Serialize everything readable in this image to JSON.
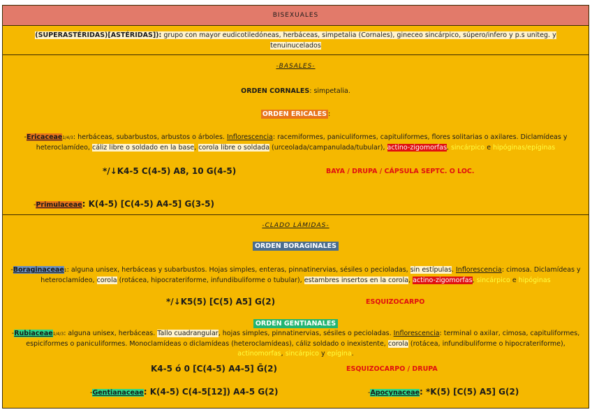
{
  "header": {
    "title": "BISEXUALES"
  },
  "intro": {
    "label": "(SUPERASTÉRIDAS)[ASTÉRIDAS]):",
    "text": " grupo con mayor eudicotiledóneas, herbáceas, simpetalia (Cornales), gineceo sincárpico, súpero/infero y p.s uniteg. y tenuinucelados"
  },
  "basales": {
    "title": "-BASALES-",
    "cornales_label": "ORDEN CORNALES",
    "cornales_text": ": simpetalia.",
    "ericales_label": "ORDEN ERICALES",
    "ericales_colon": ":",
    "ericaceae": {
      "name": "Ericaceae",
      "sub": "1/4/3",
      "t1": ": herbáceas, subarbustos, arbustos o árboles. ",
      "infl": "Inflorescencia",
      "t2": ": racemiformes, paniculiformes, capituliformes, flores solitarias o axilares. Diclamídeas y heteroclamídeo, ",
      "caliz": "cáliz libre o soldado en la base",
      "t3": ", ",
      "corola": "corola libre o soldada",
      "t4": " (urceolada/campanulada/tubular), ",
      "actino": "actino-zigomorfas",
      "comma": ", ",
      "sincarpico": "sincárpico",
      "e": " e ",
      "hipoginas": "hipóginas/epíginas",
      "formula": "*/↓K4-5 C(4-5) A8, 10 G(4-5)",
      "fruit": "BAYA / DRUPA / CÁPSULA SEPTC. O LOC."
    },
    "primulaceae": {
      "name": "Primulaceae",
      "formula": ": K(4-5) [C(4-5) A4-5] G(3-5)"
    }
  },
  "lamidas": {
    "title": "-CLADO LÁMIDAS-",
    "boraginales_label": "ORDEN BORAGINALES",
    "boraginaceae": {
      "name": "Boraginaceae",
      "sub": "1",
      "t1": ": alguna unisex, herbáceas y subarbustos. Hojas simples, enteras, pinnatinervias, sésiles o pecioladas, ",
      "sin": "sin estípulas",
      "t2": ". ",
      "infl": "Inflorescencia",
      "t3": ": cimosa. Diclamídeas y heteroclamídeo, ",
      "corola": "corola",
      "t4": " (rotácea, hipocrateriforme, infundibuliforme o tubular), ",
      "estambres": "estambres insertos en la corola",
      "comma": ", ",
      "actino": "actino-zigomorfas",
      "comma2": ", ",
      "sincarpico": "sincárpico",
      "e": " e ",
      "hipoginas": "hipóginas",
      "formula": "*/↓K5(5) [C(5) A5] G(2)",
      "fruit": "ESQUIZOCARPO"
    },
    "gentianales_label": "ORDEN GENTIANALES",
    "rubiaceae": {
      "name": "Rubiaceae",
      "sub": "1/4/3",
      "t1": ": alguna unisex, herbáceas. ",
      "tallo": "Tallo cuadrangular",
      "t2": ", hojas simples, pinnatinervias, sésiles o pecioladas. ",
      "infl": "Inflorescencia",
      "t3": ": terminal o axilar, cimosa, capituliformes, espiciformes o paniculiformes. Monoclamídeas o diclamídeas (heteroclamídeas), cáliz soldado o inexistente, ",
      "corola": "corola",
      "t4": " (rotácea, infundibuliforme o hipocrateriforme), ",
      "actino": "actinomorfas",
      "comma": ", ",
      "sincarpico": "sincárpico",
      "y": " y ",
      "epigina": "epígina",
      "dot": ".",
      "formula": "K4-5 ó 0 [C(4-5) A4-5] Ḡ(2)",
      "fruit": "ESQUIZOCARPO / DRUPA"
    },
    "gentianaceae": {
      "name": "Gentianaceae",
      "formula": ": K(4-5) C(4-5[12]) A4-5 G(2)"
    },
    "apocynaceae": {
      "name": "Apocynaceae",
      "formula": ": *K(5) [C(5) A5] G(2)"
    }
  }
}
